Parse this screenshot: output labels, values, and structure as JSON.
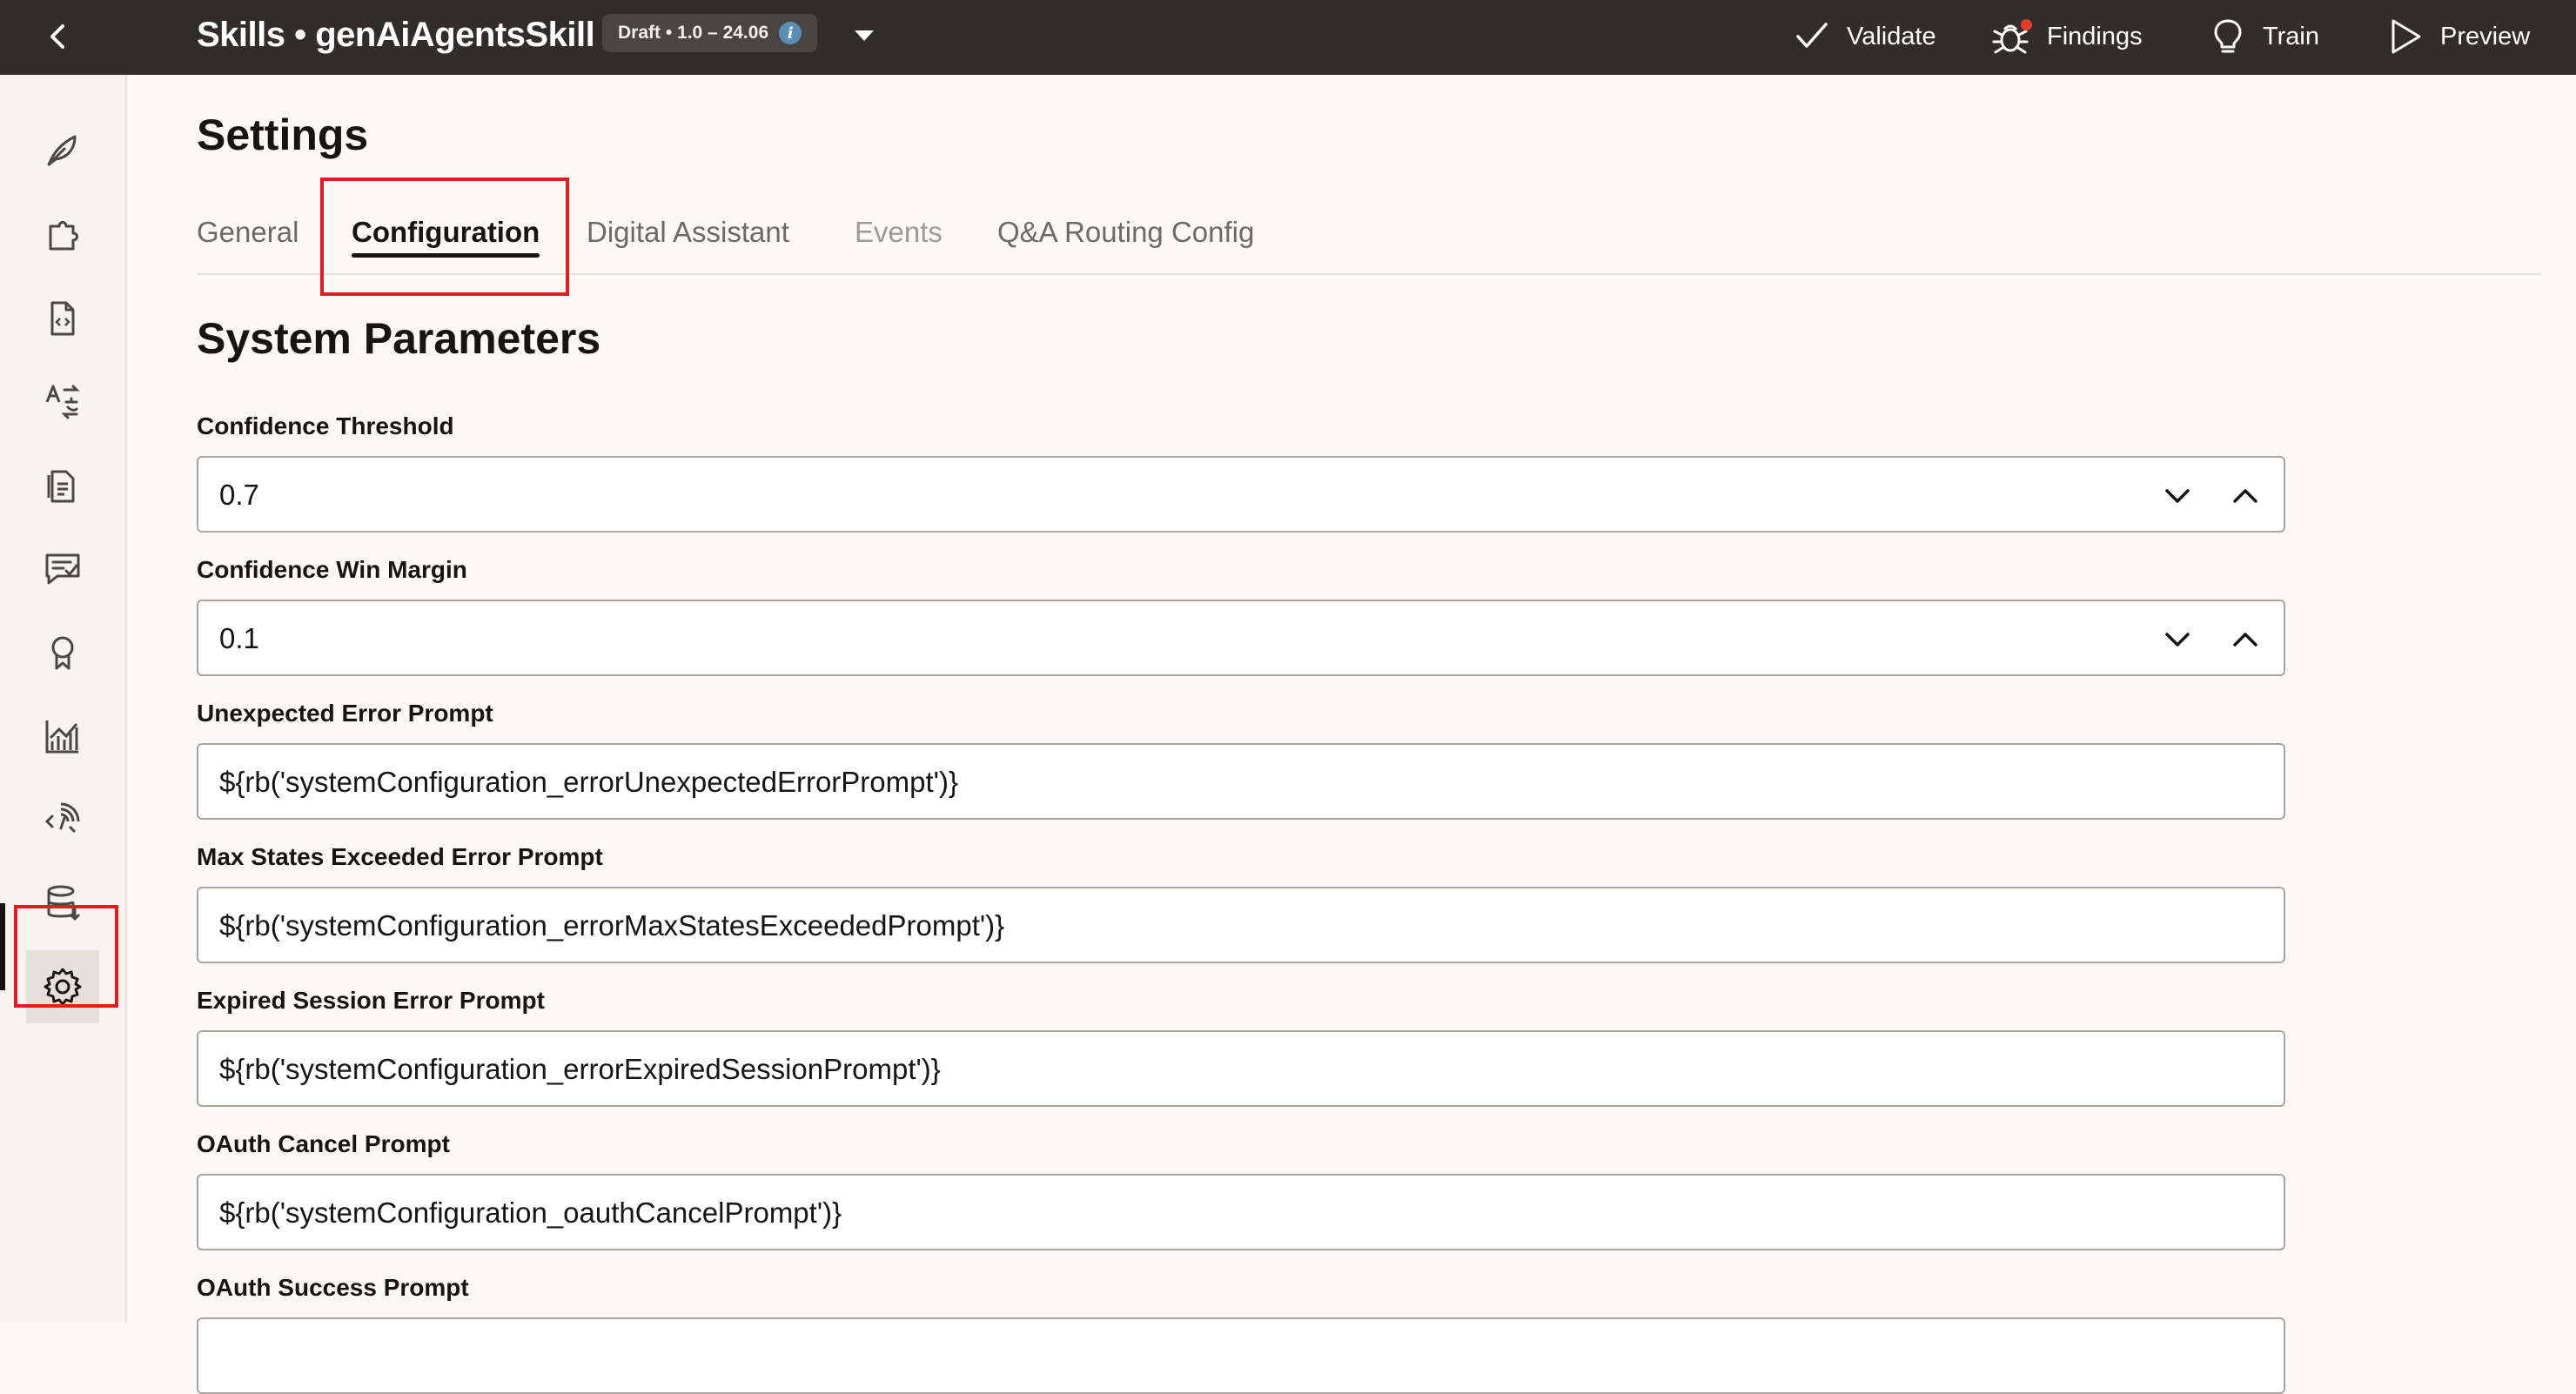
{
  "topbar": {
    "title": "Skills • genAiAgentsSkill",
    "version_badge": "Draft • 1.0 – 24.06",
    "actions": [
      {
        "label": "Validate",
        "icon": "checkmark-icon"
      },
      {
        "label": "Findings",
        "icon": "bug-icon"
      },
      {
        "label": "Train",
        "icon": "lightbulb-icon"
      },
      {
        "label": "Preview",
        "icon": "play-icon"
      }
    ]
  },
  "leftrail": {
    "items": [
      {
        "icon": "feather-icon"
      },
      {
        "icon": "puzzle-icon"
      },
      {
        "icon": "code-file-icon"
      },
      {
        "icon": "translate-icon"
      },
      {
        "icon": "document-icon"
      },
      {
        "icon": "chat-check-icon"
      },
      {
        "icon": "award-icon"
      },
      {
        "icon": "analytics-chart-icon"
      },
      {
        "icon": "api-code-icon"
      },
      {
        "icon": "database-download-icon"
      },
      {
        "icon": "gear-icon",
        "selected": true
      }
    ]
  },
  "page": {
    "title": "Settings",
    "tabs": [
      {
        "label": "General"
      },
      {
        "label": "Configuration",
        "active": true
      },
      {
        "label": "Digital Assistant"
      },
      {
        "label": "Events",
        "disabled": true
      },
      {
        "label": "Q&A Routing Config"
      }
    ],
    "section_title": "System Parameters",
    "fields": [
      {
        "label": "Confidence Threshold",
        "value": "0.7",
        "type": "number"
      },
      {
        "label": "Confidence Win Margin",
        "value": "0.1",
        "type": "number"
      },
      {
        "label": "Unexpected Error Prompt",
        "value": "${rb('systemConfiguration_errorUnexpectedErrorPrompt')}",
        "type": "text"
      },
      {
        "label": "Max States Exceeded Error Prompt",
        "value": "${rb('systemConfiguration_errorMaxStatesExceededPrompt')}",
        "type": "text"
      },
      {
        "label": "Expired Session Error Prompt",
        "value": "${rb('systemConfiguration_errorExpiredSessionPrompt')}",
        "type": "text"
      },
      {
        "label": "OAuth Cancel Prompt",
        "value": "${rb('systemConfiguration_oauthCancelPrompt')}",
        "type": "text"
      },
      {
        "label": "OAuth Success Prompt",
        "value": "",
        "type": "text"
      }
    ]
  },
  "colors": {
    "topbar_bg": "#312d2a",
    "highlight": "#e31b23",
    "page_bg": "#faf9f7"
  }
}
